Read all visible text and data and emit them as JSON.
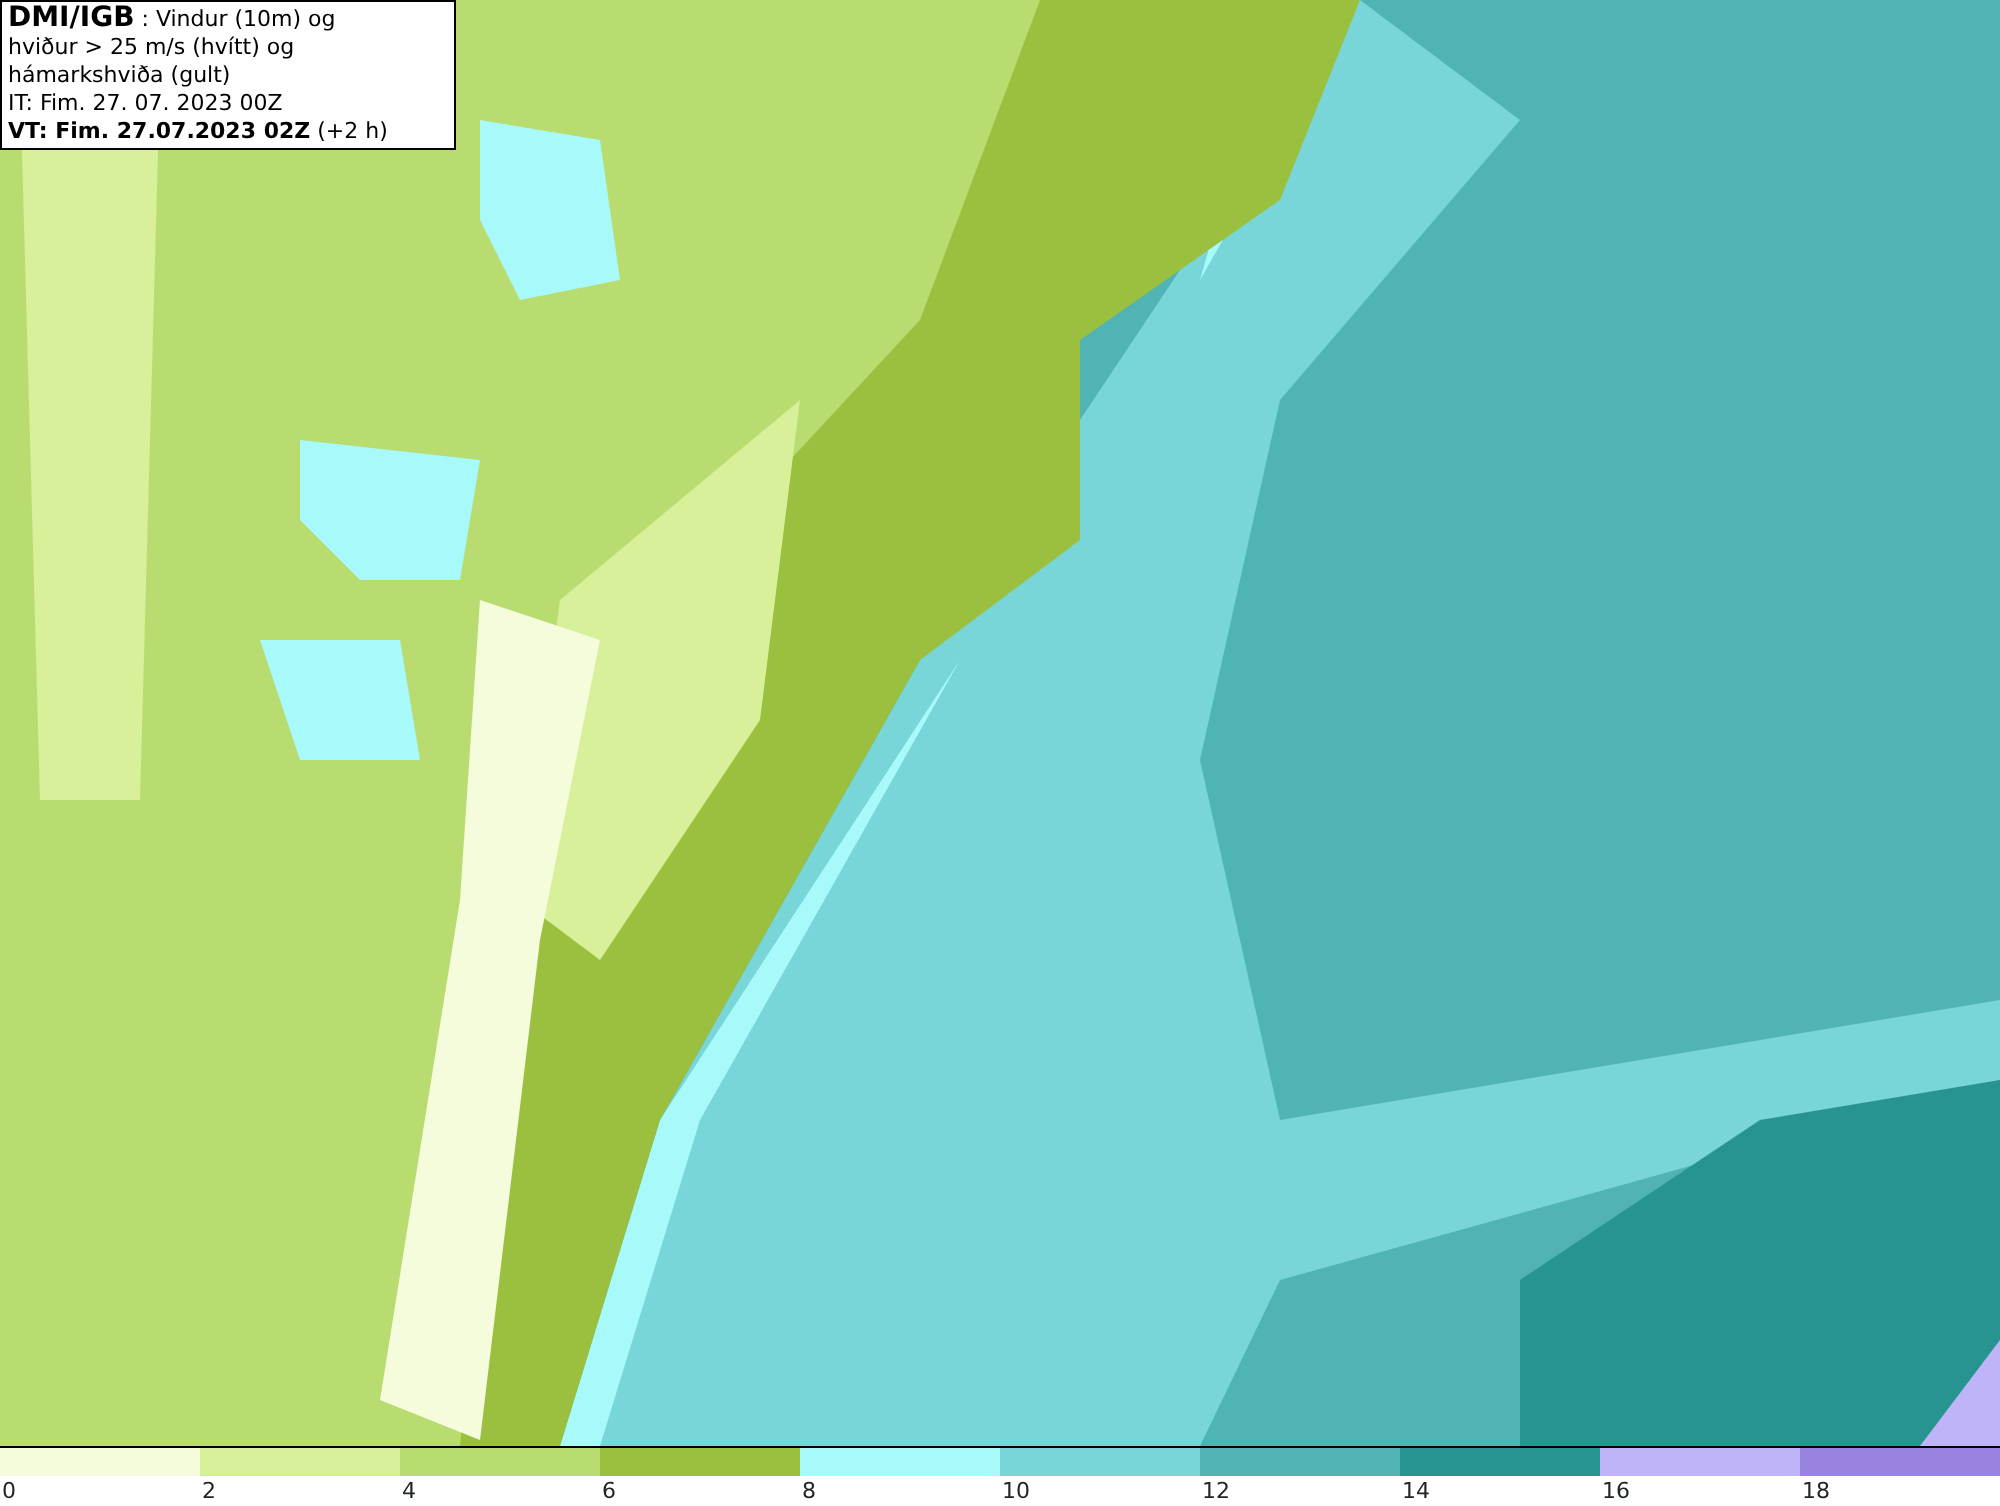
{
  "title_box": {
    "lines": [
      "**DMI/IGB** : Vindur (10m) og",
      "hviður > 25 m/s (hvítt) og hámarkshviða (gult)",
      "IT: Fim. 27. 07. 2023 00Z",
      "**VT: Fim. 27.07.2023 02Z** (+2 h)"
    ]
  },
  "legend": [
    {
      "label": "0",
      "color": "#f5fcdc"
    },
    {
      "label": "2",
      "color": "#d8f09a"
    },
    {
      "label": "4",
      "color": "#b8dc70"
    },
    {
      "label": "6",
      "color": "#9bc040"
    },
    {
      "label": "8",
      "color": "#a8fafa"
    },
    {
      "label": "10",
      "color": "#78d6d8"
    },
    {
      "label": "12",
      "color": "#50b4b4"
    },
    {
      "label": "14",
      "color": "#289490"
    },
    {
      "label": "16",
      "color": "#c0b4f8"
    },
    {
      "label": "18",
      "color": "#9a82e0"
    }
  ]
}
